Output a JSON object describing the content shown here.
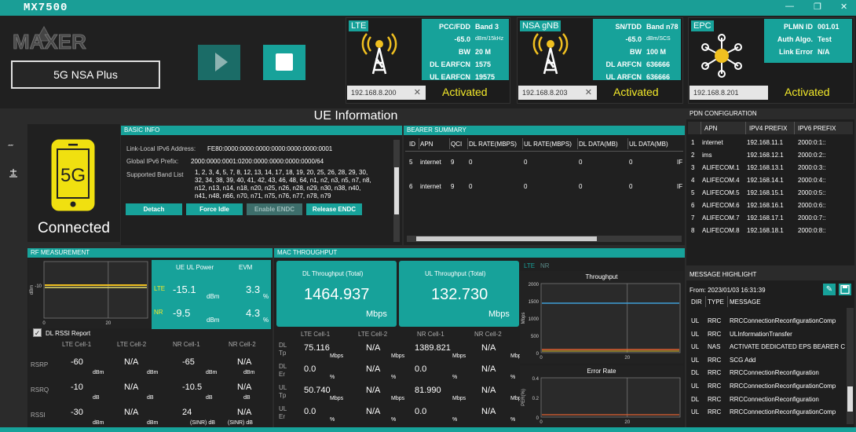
{
  "app": {
    "title": "MX7500",
    "logo_text": "MAXER",
    "mode_label": "5G NSA Plus"
  },
  "lte": {
    "label": "LTE",
    "keys": [
      "PCC/FDD",
      "",
      "BW",
      "DL EARFCN",
      "UL EARFCN"
    ],
    "vals": [
      "Band 3",
      "-65.0",
      "20 M",
      "1575",
      "19575"
    ],
    "units": [
      "",
      "dBm/15kHz",
      "",
      "",
      ""
    ],
    "ip": "192.168.8.200",
    "status": "Activated"
  },
  "nr": {
    "label": "NSA gNB",
    "keys": [
      "SN/TDD",
      "",
      "BW",
      "DL ARFCN",
      "UL ARFCN"
    ],
    "vals": [
      "Band n78",
      "-65.0",
      "100 M",
      "636666",
      "636666"
    ],
    "units": [
      "",
      "dBm/SCS",
      "",
      "",
      ""
    ],
    "ip": "192.168.8.203",
    "status": "Activated"
  },
  "epc": {
    "label": "EPC",
    "keys": [
      "PLMN ID",
      "Auth Algo.",
      "Link Error"
    ],
    "vals": [
      "001.01",
      "Test",
      "N/A"
    ],
    "ip": "192.168.8.201",
    "status": "Activated"
  },
  "ue": {
    "title": "UE Information",
    "phone_text": "5G",
    "state": "Connected"
  },
  "basic_info": {
    "header": "BASIC INFO",
    "ipv6_label": "Link-Local IPv6 Address:",
    "ipv6": "FE80:0000:0000:0000:0000:0000:0000:0001",
    "gipv6_label": "Global IPv6 Prefix:",
    "gipv6": "2000:0000:0001:0200:0000:0000:0000:0000/64",
    "bands_label": "Supported Band List",
    "bands": [
      "1, 2, 3, 4, 5, 7, 8, 12, 13, 14, 17, 18, 19, 20, 25, 26, 28, 29, 30,",
      "32, 34, 38, 39, 40, 41, 42, 43, 46, 48, 64, n1, n2, n3, n5, n7, n8,",
      "n12, n13, n14, n18, n20, n25, n26, n28, n29, n30, n38, n40,",
      "n41, n48, n66, n70, n71, n75, n76, n77, n78, n79"
    ],
    "buttons": [
      "Detach",
      "Force Idle",
      "Enable ENDC",
      "Release ENDC"
    ]
  },
  "bearer": {
    "header": "BEARER SUMMARY",
    "cols": [
      "ID",
      "APN",
      "QCI",
      "DL RATE(MBPS)",
      "UL RATE(MBPS)",
      "DL DATA(MB)",
      "UL DATA(MB)",
      "IF"
    ],
    "rows": [
      [
        "5",
        "internet",
        "9",
        "0",
        "0",
        "0",
        "0",
        "IF"
      ],
      [
        "6",
        "internet",
        "9",
        "0",
        "0",
        "0",
        "0",
        "IF"
      ]
    ]
  },
  "pdn": {
    "header": "PDN CONFIGURATION",
    "cols": [
      "APN",
      "IPV4 PREFIX",
      "IPV6 PREFIX"
    ],
    "rows": [
      [
        "1",
        "internet",
        "192.168.11.1",
        "2000:0:1::"
      ],
      [
        "2",
        "ims",
        "192.168.12.1",
        "2000:0:2::"
      ],
      [
        "3",
        "ALIFECOM.1",
        "192.168.13.1",
        "2000:0:3::"
      ],
      [
        "4",
        "ALIFECOM.4",
        "192.168.14.1",
        "2000:0:4::"
      ],
      [
        "5",
        "ALIFECOM.5",
        "192.168.15.1",
        "2000:0:5::"
      ],
      [
        "6",
        "ALIFECOM.6",
        "192.168.16.1",
        "2000:0:6::"
      ],
      [
        "7",
        "ALIFECOM.7",
        "192.168.17.1",
        "2000:0:7::"
      ],
      [
        "8",
        "ALIFECOM.8",
        "192.168.18.1",
        "2000:0:8::"
      ]
    ]
  },
  "rf": {
    "header": "RF MEASUREMENT",
    "chart": {
      "ylabel": "dBm",
      "ytick": "-10",
      "xticks": [
        "0",
        "20"
      ]
    },
    "power_hdr": "UE UL Power",
    "evm_hdr": "EVM",
    "lte_label": "LTE",
    "lte_power": "-15.1",
    "lte_evm": "3.3",
    "nr_label": "NR",
    "nr_power": "-9.5",
    "nr_evm": "4.3",
    "dbm": "dBm",
    "pct": "%",
    "rssi_report": "DL RSSI Report",
    "cols": [
      "LTE Cell-1",
      "LTE Cell-2",
      "NR Cell-1",
      "NR Cell-2"
    ],
    "rows": [
      {
        "label": "RSRP",
        "vals": [
          "-60",
          "N/A",
          "-65",
          "N/A"
        ],
        "units": [
          "dBm",
          "dBm",
          "dBm",
          "dBm"
        ]
      },
      {
        "label": "RSRQ",
        "vals": [
          "-10",
          "N/A",
          "-10.5",
          "N/A"
        ],
        "units": [
          "dB",
          "dB",
          "dB",
          "dB"
        ]
      },
      {
        "label": "RSSI",
        "vals": [
          "-30",
          "N/A",
          "24",
          "N/A"
        ],
        "units": [
          "dBm",
          "dBm",
          "(SINR) dB",
          "(SINR) dB"
        ]
      }
    ]
  },
  "mac": {
    "header": "MAC THROUGHPUT",
    "dl_title": "DL Throughput (Total)",
    "dl_value": "1464.937",
    "ul_title": "UL Throughput (Total)",
    "ul_value": "132.730",
    "unit": "Mbps",
    "cols": [
      "LTE Cell-1",
      "LTE Cell-2",
      "NR Cell-1",
      "NR Cell-2"
    ],
    "rows": [
      {
        "label": [
          "DL",
          "Tp"
        ],
        "vals": [
          "75.116",
          "N/A",
          "1389.821",
          "N/A"
        ],
        "units": [
          "Mbps",
          "Mbps",
          "Mbps",
          "Mbps"
        ]
      },
      {
        "label": [
          "DL",
          "Er"
        ],
        "vals": [
          "0.0",
          "N/A",
          "0.0",
          "N/A"
        ],
        "units": [
          "%",
          "%",
          "%",
          "%"
        ]
      },
      {
        "label": [
          "UL",
          "Tp"
        ],
        "vals": [
          "50.740",
          "N/A",
          "81.990",
          "N/A"
        ],
        "units": [
          "Mbps",
          "Mbps",
          "Mbps",
          "Mbps"
        ]
      },
      {
        "label": [
          "UL",
          "Er"
        ],
        "vals": [
          "0.0",
          "N/A",
          "0.0",
          "N/A"
        ],
        "units": [
          "%",
          "%",
          "%",
          "%"
        ]
      }
    ],
    "tabs": [
      "LTE",
      "NR"
    ],
    "tp_chart": {
      "title": "Throughput",
      "ylabel": "Mbps",
      "yticks": [
        "2000",
        "1500",
        "1000",
        "500",
        "0"
      ],
      "xticks": [
        "0",
        "20"
      ]
    },
    "er_chart": {
      "title": "Error Rate",
      "ylabel": "PER(%)",
      "yticks": [
        "0.4",
        "0.2",
        "0"
      ],
      "xticks": [
        "0",
        "20"
      ]
    }
  },
  "msg": {
    "header": "MESSAGE HIGHLIGHT",
    "from": "From: 2023/01/03 16:31:39",
    "cols": [
      "DIR",
      "TYPE",
      "MESSAGE"
    ],
    "rows": [
      [
        "UL",
        "RRC",
        "RRCConnectionReconfigurationComp"
      ],
      [
        "UL",
        "RRC",
        "ULInformationTransfer"
      ],
      [
        "UL",
        "NAS",
        "ACTIVATE DEDICATED EPS BEARER C"
      ],
      [
        "UL",
        "RRC",
        "SCG Add"
      ],
      [
        "DL",
        "RRC",
        "RRCConnectionReconfiguration"
      ],
      [
        "UL",
        "RRC",
        "RRCConnectionReconfigurationComp"
      ],
      [
        "DL",
        "RRC",
        "RRCConnectionReconfiguration"
      ],
      [
        "UL",
        "RRC",
        "RRCConnectionReconfigurationComp"
      ]
    ]
  }
}
